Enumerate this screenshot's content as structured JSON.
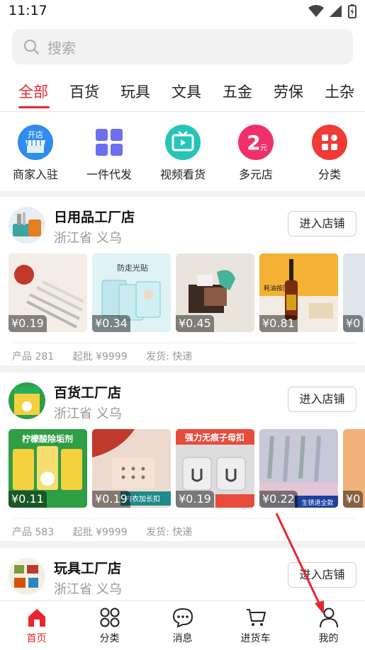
{
  "status": {
    "time": "11:17"
  },
  "search": {
    "placeholder": "搜索"
  },
  "tabs": [
    "全部",
    "百货",
    "玩具",
    "文具",
    "五金",
    "劳保",
    "土杂"
  ],
  "quick": [
    {
      "label": "商家入驻",
      "icon": "storefront-icon",
      "badge": "开店"
    },
    {
      "label": "一件代发",
      "icon": "grid-apps-icon"
    },
    {
      "label": "视频看货",
      "icon": "tv-icon"
    },
    {
      "label": "多元店",
      "icon": "two-yuan-icon",
      "badge": "2",
      "sub": "元"
    },
    {
      "label": "分类",
      "icon": "category-icon"
    }
  ],
  "shops": [
    {
      "name": "日用品工厂店",
      "location": "浙江省 义乌",
      "enter": "进入店铺",
      "products": [
        {
          "price": "¥0.19",
          "icon": "forks-product",
          "caption": ""
        },
        {
          "price": "¥0.34",
          "icon": "film-product",
          "caption": "防走光贴"
        },
        {
          "price": "¥0.45",
          "icon": "clip-product",
          "caption": ""
        },
        {
          "price": "¥0.81",
          "icon": "pump-product",
          "caption": "耗油按压器"
        },
        {
          "price": "¥0",
          "icon": "partial-product",
          "caption": ""
        }
      ],
      "meta": {
        "products": "产品 281",
        "minimum": "起批 ¥9999",
        "shipping": "发货: 快递"
      }
    },
    {
      "name": "百货工厂店",
      "location": "浙江省 义乌",
      "enter": "进入店铺",
      "products": [
        {
          "price": "¥0.11",
          "icon": "descaler-product",
          "caption": "柠檬酸除垢剂"
        },
        {
          "price": "¥0.19",
          "icon": "hook-product",
          "caption": "内衣加长扣"
        },
        {
          "price": "¥0.19",
          "icon": "hanger-product",
          "caption": "强力无痕子母扣"
        },
        {
          "price": "¥0.22",
          "icon": "clips-product",
          "caption": "生锈退全款"
        },
        {
          "price": "¥0",
          "icon": "partial-product",
          "caption": ""
        }
      ],
      "meta": {
        "products": "产品 583",
        "minimum": "起批 ¥9999",
        "shipping": "发货: 快递"
      }
    },
    {
      "name": "玩具工厂店",
      "location": "浙江省 义乌",
      "enter": "进入店铺"
    }
  ],
  "nav": [
    {
      "label": "首页",
      "icon": "home-icon"
    },
    {
      "label": "分类",
      "icon": "grid-icon"
    },
    {
      "label": "消息",
      "icon": "message-icon"
    },
    {
      "label": "进货车",
      "icon": "cart-icon"
    },
    {
      "label": "我的",
      "icon": "user-icon"
    }
  ],
  "colors": {
    "accent": "#e8262d",
    "muted": "#999999"
  }
}
